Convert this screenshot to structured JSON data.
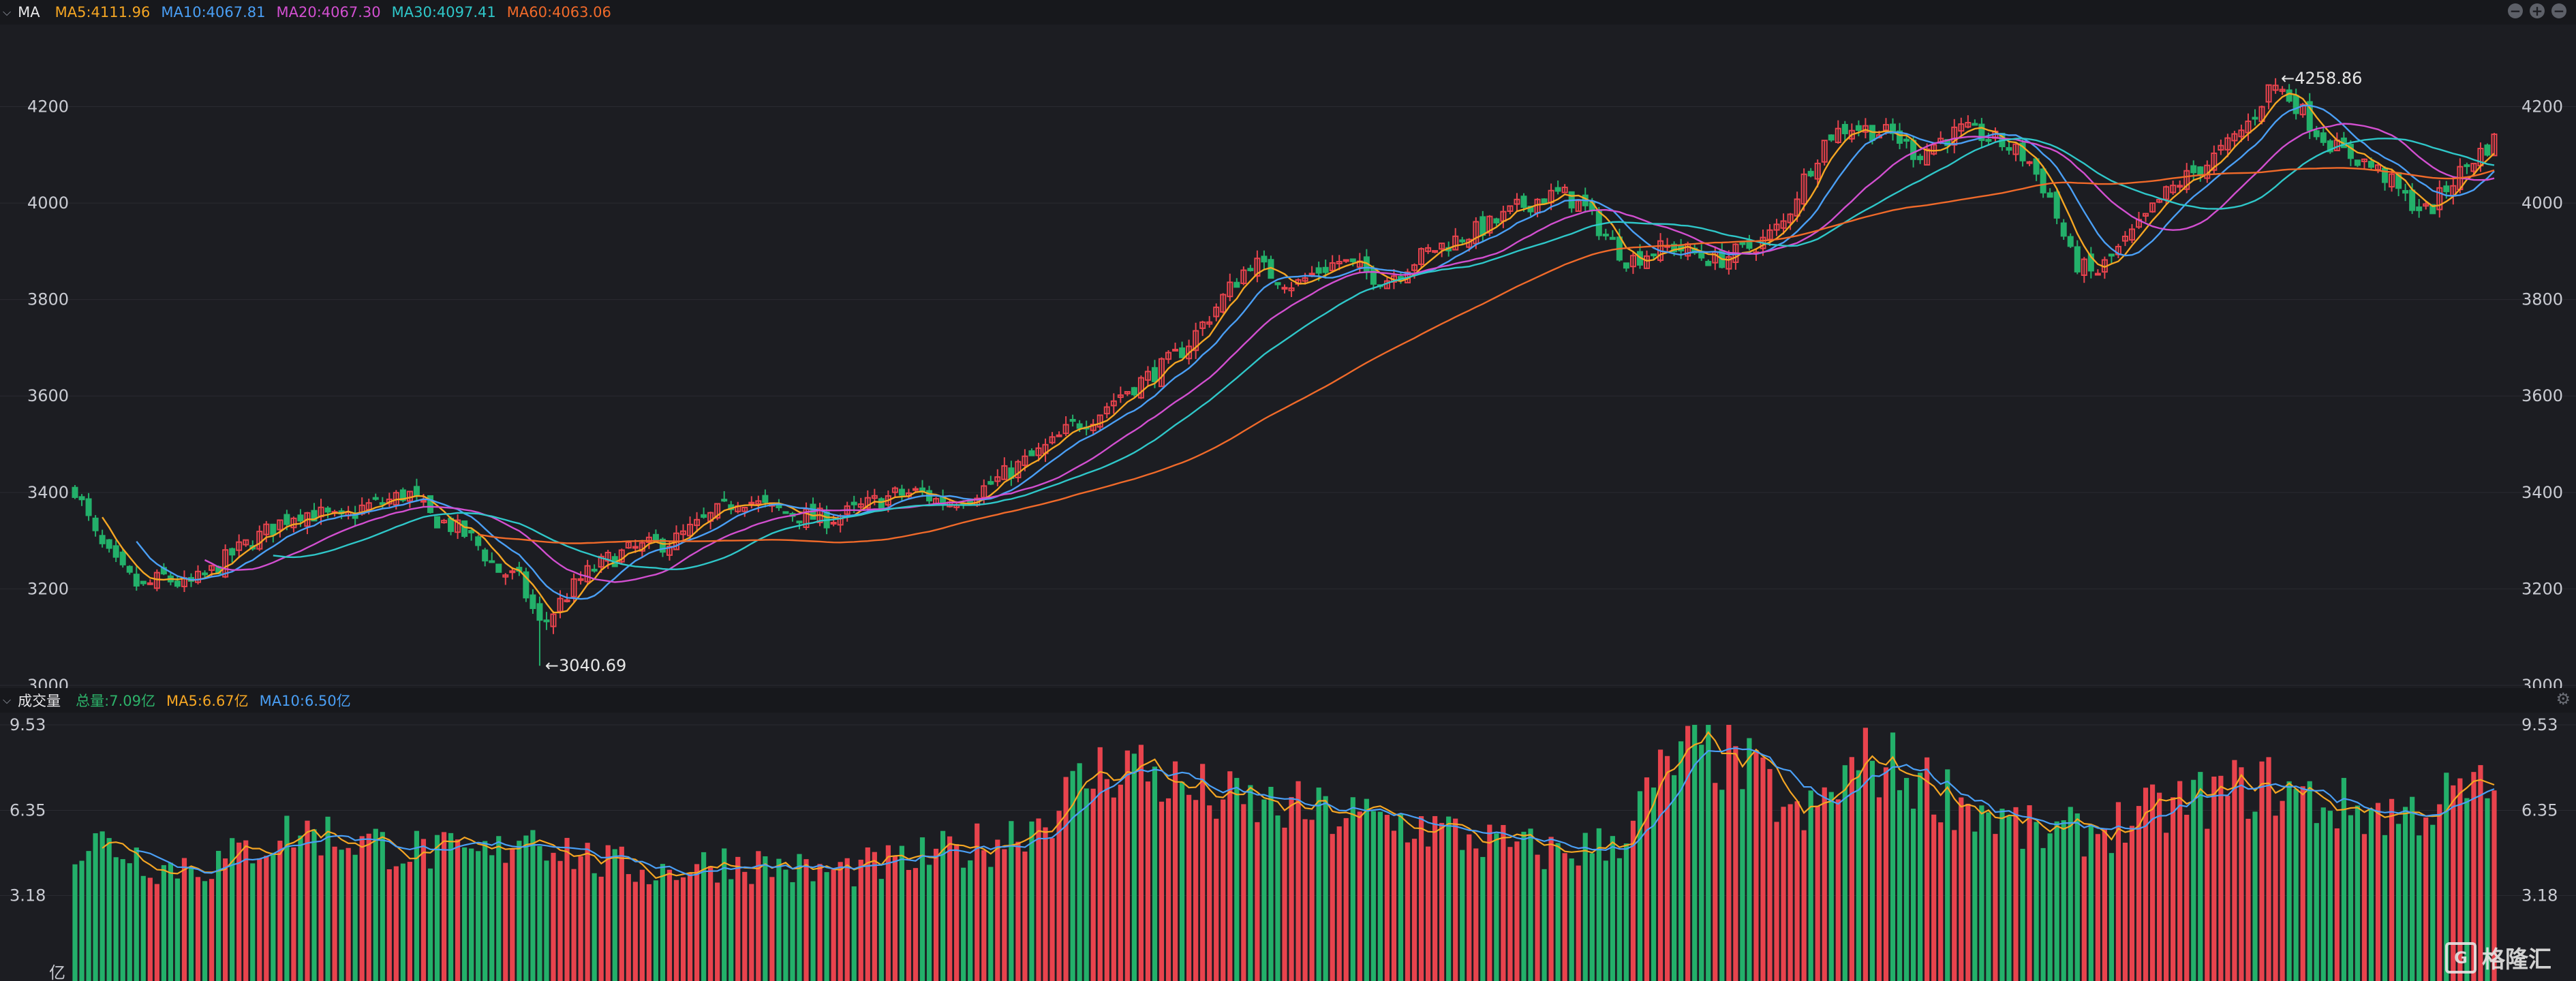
{
  "price_panel": {
    "name": "MA",
    "legend": [
      {
        "label": "MA5:4111.96",
        "color": "#f5a623"
      },
      {
        "label": "MA10:4067.81",
        "color": "#4a9ff5"
      },
      {
        "label": "MA20:4067.30",
        "color": "#d24fd0"
      },
      {
        "label": "MA30:4097.41",
        "color": "#2fc7c9"
      },
      {
        "label": "MA60:4063.06",
        "color": "#f06a2a"
      }
    ],
    "high_label": "4258.86",
    "low_label": "3040.69"
  },
  "volume_panel": {
    "name": "成交量",
    "legend": [
      {
        "label": "总量:7.09亿",
        "color": "#2db36a"
      },
      {
        "label": "MA5:6.67亿",
        "color": "#f5a623"
      },
      {
        "label": "MA10:6.50亿",
        "color": "#4a9ff5"
      }
    ],
    "unit": "亿"
  },
  "watermark": {
    "text": "格隆汇"
  },
  "colors": {
    "up": "#e8434d",
    "down": "#23b06a",
    "bg": "#1c1d22",
    "grid": "#2a2b31"
  },
  "chart_data": [
    {
      "type": "candlestick",
      "ylim": [
        3000,
        4260
      ],
      "yticks": [
        3000,
        3200,
        3400,
        3600,
        3800,
        4000,
        4200
      ],
      "high": 4258.86,
      "low": 3040.69,
      "close_path": [
        3410,
        3300,
        3240,
        3200,
        3225,
        3205,
        3230,
        3270,
        3300,
        3330,
        3360,
        3355,
        3340,
        3370,
        3380,
        3400,
        3350,
        3330,
        3300,
        3240,
        3220,
        3120,
        3180,
        3230,
        3260,
        3280,
        3290,
        3300,
        3330,
        3360,
        3390,
        3370,
        3360,
        3350,
        3345,
        3360,
        3380,
        3395,
        3400,
        3380,
        3390,
        3410,
        3440,
        3470,
        3500,
        3540,
        3560,
        3600,
        3630,
        3660,
        3700,
        3760,
        3820,
        3880,
        3850,
        3830,
        3860,
        3880,
        3860,
        3840,
        3870,
        3900,
        3920,
        3940,
        3960,
        3990,
        4010,
        4020,
        3990,
        3930,
        3880,
        3900,
        3910,
        3895,
        3880,
        3900,
        3920,
        3960,
        4060,
        4140,
        4160,
        4150,
        4140,
        4100,
        4130,
        4150,
        4140,
        4120,
        4090,
        4010,
        3880,
        3850,
        3900,
        3950,
        4010,
        4050,
        4080,
        4120,
        4170,
        4250,
        4210,
        4150,
        4110,
        4090,
        4060,
        4010,
        3980,
        4040,
        4090,
        4130
      ],
      "ma_lines": [
        {
          "name": "MA5",
          "color": "#f5a623"
        },
        {
          "name": "MA10",
          "color": "#4a9ff5"
        },
        {
          "name": "MA20",
          "color": "#d24fd0"
        },
        {
          "name": "MA30",
          "color": "#2fc7c9"
        },
        {
          "name": "MA60",
          "color": "#f06a2a"
        }
      ]
    },
    {
      "type": "bar",
      "ylim": [
        0,
        9.53
      ],
      "yticks": [
        9.53,
        6.35,
        3.18
      ],
      "values_path": [
        4.8,
        5.2,
        5.0,
        4.6,
        4.2,
        4.4,
        4.3,
        4.6,
        5.0,
        5.4,
        5.6,
        5.5,
        5.3,
        5.2,
        5.0,
        4.9,
        4.8,
        4.7,
        4.6,
        4.8,
        5.8,
        5.3,
        4.9,
        4.5,
        4.3,
        4.2,
        4.1,
        4.2,
        4.3,
        4.5,
        4.4,
        4.3,
        4.2,
        4.0,
        4.1,
        4.2,
        4.3,
        4.4,
        4.6,
        4.8,
        5.0,
        5.2,
        5.6,
        6.0,
        6.6,
        7.4,
        7.9,
        8.2,
        7.8,
        7.3,
        7.0,
        6.8,
        6.6,
        6.5,
        6.4,
        6.3,
        6.2,
        6.1,
        6.0,
        5.9,
        5.8,
        5.6,
        5.4,
        5.2,
        5.0,
        4.9,
        4.8,
        4.9,
        5.0,
        5.4,
        6.6,
        7.8,
        8.4,
        8.6,
        8.2,
        7.6,
        6.8,
        5.8,
        6.6,
        7.6,
        8.2,
        8.0,
        7.6,
        7.2,
        6.8,
        6.4,
        6.0,
        5.6,
        5.4,
        5.5,
        5.6,
        5.8,
        6.0,
        6.3,
        6.6,
        6.8,
        7.0,
        7.2,
        7.3,
        7.0,
        6.7,
        6.5,
        6.4,
        6.3,
        6.2,
        6.5,
        6.8,
        7.0,
        7.09
      ]
    }
  ]
}
